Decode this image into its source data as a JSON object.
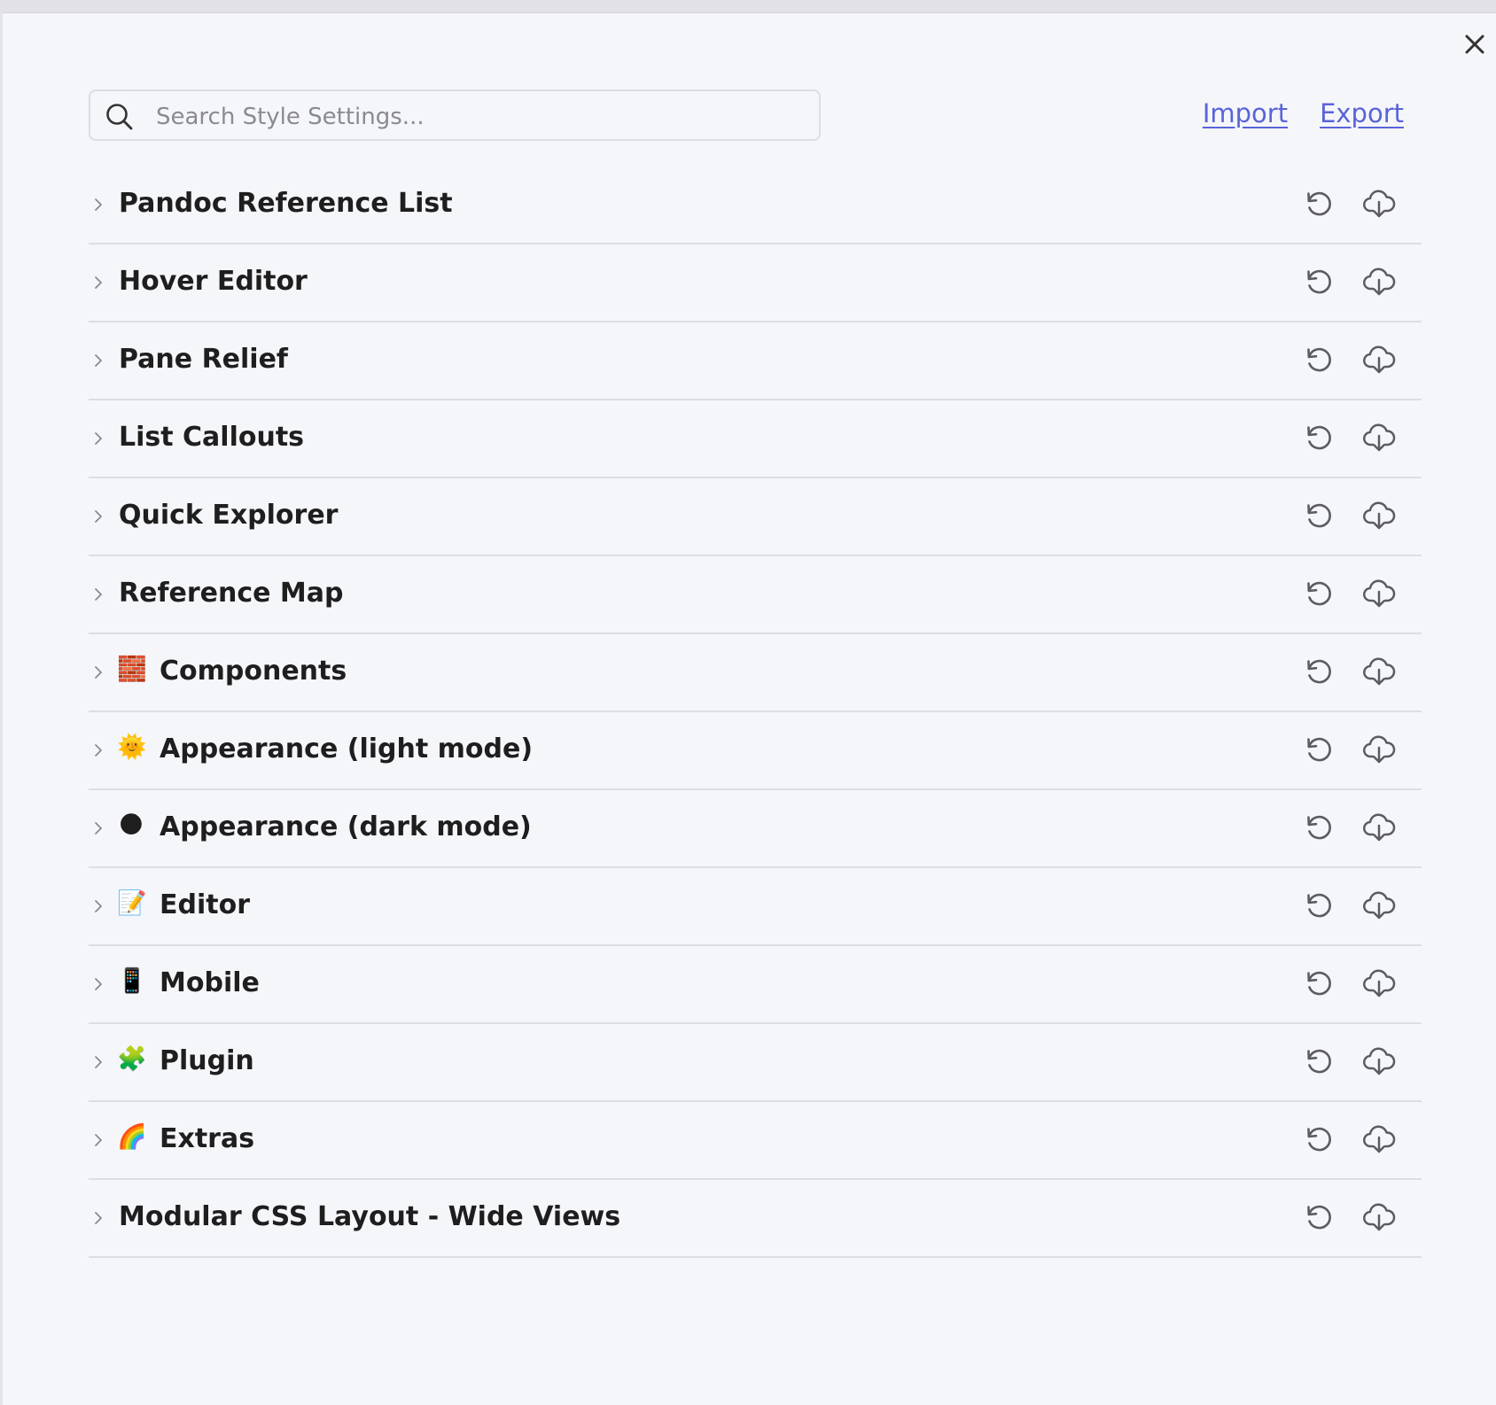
{
  "search": {
    "placeholder": "Search Style Settings..."
  },
  "header": {
    "import_label": "Import",
    "export_label": "Export"
  },
  "sections": [
    {
      "label": "Pandoc Reference List",
      "emoji": ""
    },
    {
      "label": "Hover Editor",
      "emoji": ""
    },
    {
      "label": "Pane Relief",
      "emoji": ""
    },
    {
      "label": "List Callouts",
      "emoji": ""
    },
    {
      "label": "Quick Explorer",
      "emoji": ""
    },
    {
      "label": "Reference Map",
      "emoji": ""
    },
    {
      "label": "Components",
      "emoji": "🧱"
    },
    {
      "label": "Appearance (light mode)",
      "emoji": "🌞"
    },
    {
      "label": "Appearance (dark mode)",
      "emoji": "🌑"
    },
    {
      "label": "Editor",
      "emoji": "📝"
    },
    {
      "label": "Mobile",
      "emoji": "📱"
    },
    {
      "label": "Plugin",
      "emoji": "🧩"
    },
    {
      "label": "Extras",
      "emoji": "🌈"
    },
    {
      "label": "Modular CSS Layout - Wide Views",
      "emoji": ""
    }
  ],
  "icons": {
    "close": "close-icon",
    "search": "search-icon",
    "chevron": "chevron-right-icon",
    "reset": "reset-icon",
    "export": "cloud-download-icon"
  },
  "colors": {
    "background": "#f5f6fa",
    "accent_link": "#5964d8",
    "text": "#1e1e1e",
    "icon": "#5c5c60",
    "divider": "#dddee4"
  }
}
